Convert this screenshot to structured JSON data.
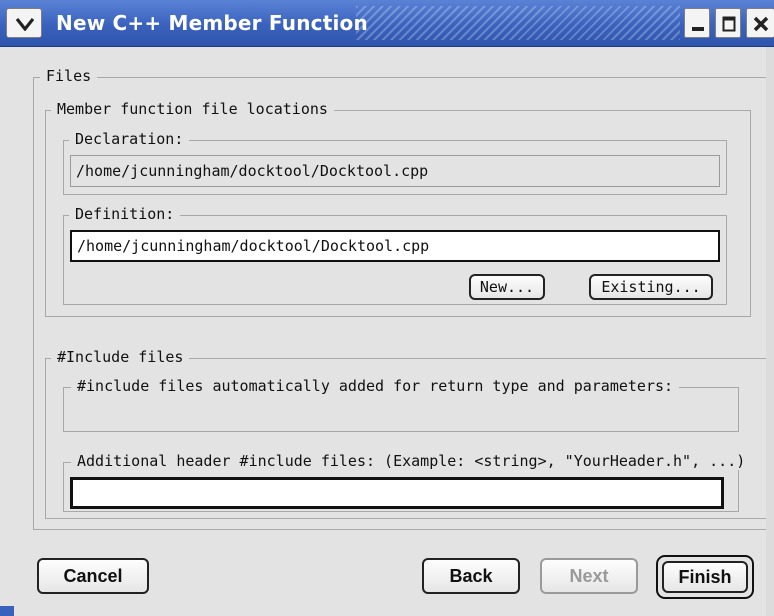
{
  "window": {
    "title": "New C++ Member Function",
    "controls": [
      "menu-icon",
      "minimize-icon",
      "maximize-icon",
      "close-icon"
    ]
  },
  "files_group": {
    "label": "Files",
    "locations": {
      "label": "Member function file locations",
      "declaration": {
        "label": "Declaration:",
        "value": "/home/jcunningham/docktool/Docktool.cpp"
      },
      "definition": {
        "label": "Definition:",
        "value": "/home/jcunningham/docktool/Docktool.cpp",
        "new_label": "New...",
        "existing_label": "Existing..."
      }
    }
  },
  "include_group": {
    "label": "#Include files",
    "auto": {
      "label": "#include files automatically added for return type and parameters:",
      "value": ""
    },
    "additional": {
      "label": "Additional header #include files: (Example: <string>, \"YourHeader.h\", ...)",
      "value": ""
    }
  },
  "buttons": {
    "cancel": "Cancel",
    "back": "Back",
    "next": "Next",
    "finish": "Finish"
  }
}
